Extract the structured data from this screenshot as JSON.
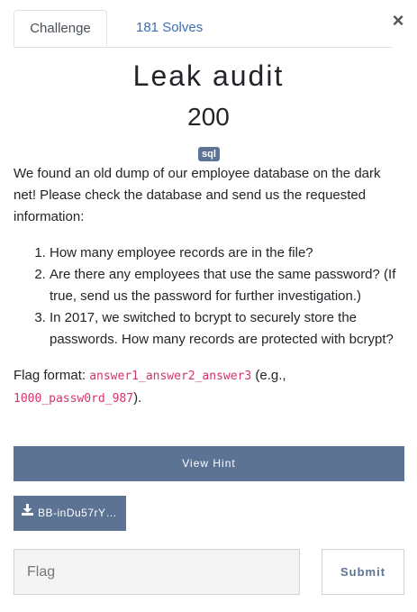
{
  "modal": {
    "close_glyph": "×"
  },
  "tabs": [
    {
      "label": "Challenge",
      "active": true
    },
    {
      "label": "181 Solves",
      "active": false
    }
  ],
  "challenge": {
    "name": "Leak audit",
    "points": "200",
    "tag": "sql",
    "intro": "We found an old dump of our employee database on the dark net! Please check the database and send us the requested information:",
    "questions": [
      "How many employee records are in the file?",
      "Are there any employees that use the same password? (If true, send us the password for further investigation.)",
      "In 2017, we switched to bcrypt to securely store the passwords. How many records are protected with bcrypt?"
    ],
    "flag_format_label": "Flag format: ",
    "flag_format_code": "answer1_answer2_answer3",
    "example_prefix": " (e.g., ",
    "example_code": "1000_passw0rd_987",
    "example_suffix": ")."
  },
  "hint_button": {
    "label": "View Hint"
  },
  "file_button": {
    "label": "BB-inDu57rY…",
    "icon": "download-icon"
  },
  "flag_input": {
    "placeholder": "Flag",
    "value": ""
  },
  "submit_button": {
    "label": "Submit"
  },
  "colors": {
    "accent": "#5c7394",
    "link": "#3b6fb6",
    "code": "#d6336c"
  }
}
